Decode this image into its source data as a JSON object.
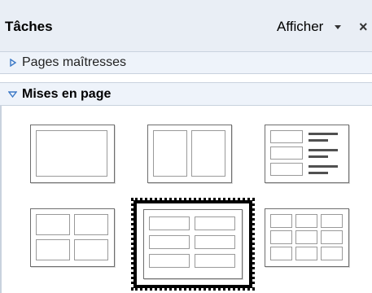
{
  "panel": {
    "title": "Tâches",
    "view_menu_label": "Afficher",
    "close_icon": "×"
  },
  "sections": [
    {
      "label": "Pages maîtresses",
      "expanded": false,
      "icon": "triangle-right-icon"
    },
    {
      "label": "Mises en page",
      "expanded": true,
      "icon": "triangle-down-icon"
    }
  ],
  "layouts": [
    {
      "name": "blank",
      "selected": false
    },
    {
      "name": "two-columns",
      "selected": false
    },
    {
      "name": "three-rows-with-text",
      "selected": false
    },
    {
      "name": "four-boxes",
      "selected": false
    },
    {
      "name": "six-boxes",
      "selected": true
    },
    {
      "name": "nine-boxes",
      "selected": false
    }
  ],
  "colors": {
    "titlebar_bg": "#e9eef5",
    "section_bg": "#eef3fa",
    "selection_border": "#000000"
  }
}
